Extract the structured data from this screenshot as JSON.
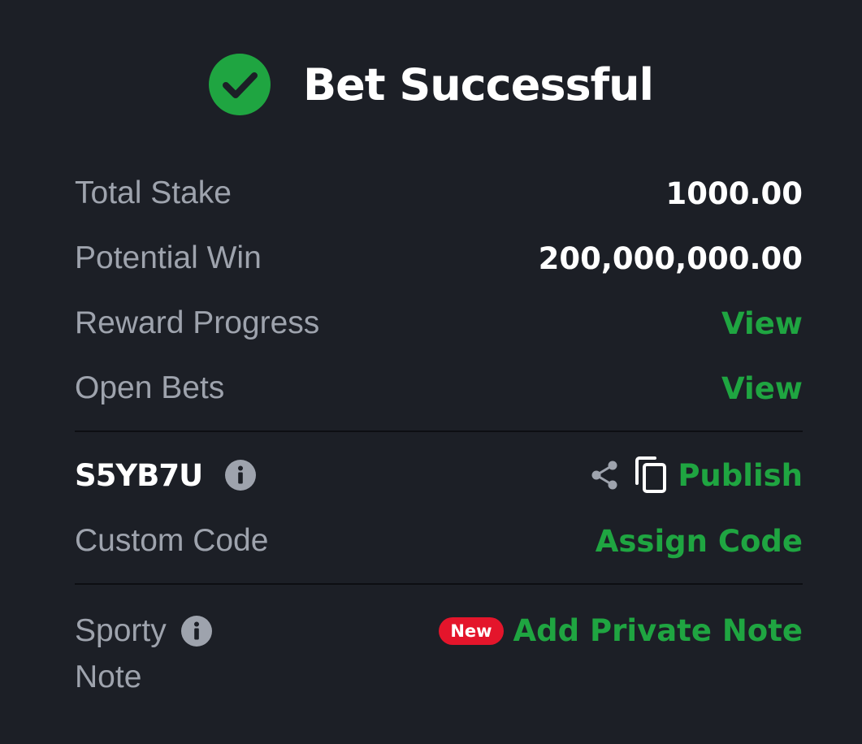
{
  "header": {
    "title": "Bet Successful",
    "icon": "check-circle-icon",
    "icon_color": "#1fa541"
  },
  "summary": {
    "total_stake_label": "Total Stake",
    "total_stake_value": "1000.00",
    "potential_win_label": "Potential Win",
    "potential_win_value": "200,000,000.00",
    "reward_progress_label": "Reward Progress",
    "reward_progress_link": "View",
    "open_bets_label": "Open Bets",
    "open_bets_link": "View"
  },
  "booking": {
    "code": "S5YB7U",
    "publish_label": "Publish",
    "custom_code_label": "Custom Code",
    "assign_code_label": "Assign Code"
  },
  "note": {
    "label_line1": "Sporty",
    "label_line2": "Note",
    "badge": "New",
    "add_note_label": "Add Private Note"
  },
  "colors": {
    "background": "#1c1f26",
    "accent_green": "#1fa541",
    "badge_red": "#e4152b",
    "label_gray": "#9ea3ad"
  }
}
